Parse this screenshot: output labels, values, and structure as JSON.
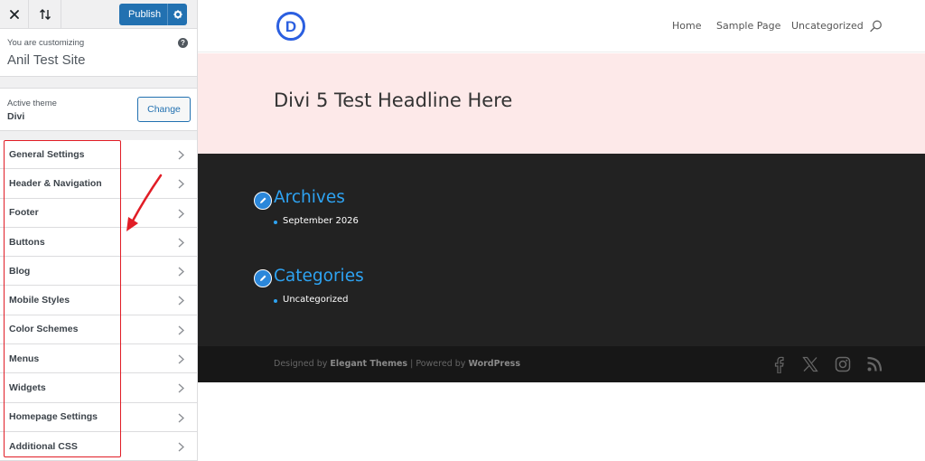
{
  "topbar": {
    "close_icon": "close-icon",
    "undo_icon": "reorder-arrows-icon",
    "publish_label": "Publish",
    "publish_settings_icon": "gear-icon"
  },
  "info": {
    "customizing_label": "You are customizing",
    "site_title": "Anil Test Site",
    "help_glyph": "?"
  },
  "theme": {
    "active_label": "Active theme",
    "name": "Divi",
    "change_label": "Change"
  },
  "sections": [
    {
      "label": "General Settings"
    },
    {
      "label": "Header & Navigation"
    },
    {
      "label": "Footer"
    },
    {
      "label": "Buttons"
    },
    {
      "label": "Blog"
    },
    {
      "label": "Mobile Styles"
    },
    {
      "label": "Color Schemes"
    },
    {
      "label": "Menus"
    },
    {
      "label": "Widgets"
    },
    {
      "label": "Homepage Settings"
    },
    {
      "label": "Additional CSS"
    }
  ],
  "site": {
    "logo_letter": "D",
    "nav": [
      "Home",
      "Sample Page",
      "Uncategorized"
    ],
    "hero_title": "Divi 5 Test Headline Here",
    "archives_title": "Archives",
    "archives_items": [
      "September 2026"
    ],
    "categories_title": "Categories",
    "categories_items": [
      "Uncategorized"
    ],
    "credits_designed_by": "Designed by",
    "credits_elegant": "Elegant Themes",
    "credits_powered_by": " | Powered by",
    "credits_wordpress": "WordPress",
    "social_icons": [
      "facebook-icon",
      "x-icon",
      "instagram-icon",
      "rss-icon"
    ]
  },
  "colors": {
    "publish_bg": "#2271b1",
    "highlight_red": "#e11d26",
    "hero_bg": "#fde9e9",
    "widgets_bg": "#222222",
    "footer_bg": "#171717",
    "accent_blue": "#2ea3f2"
  }
}
